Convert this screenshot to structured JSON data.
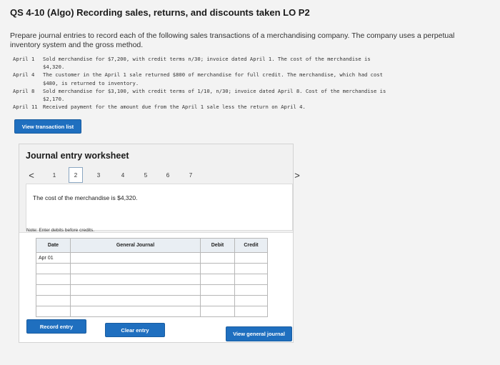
{
  "header": {
    "title": "QS 4-10 (Algo) Recording sales, returns, and discounts taken LO P2"
  },
  "instructions": "Prepare journal entries to record each of the following sales transactions of a merchandising company. The company uses a perpetual inventory system and the gross method.",
  "transactions": [
    {
      "date": "April 1",
      "line1": "Sold merchandise for $7,200, with credit terms n/30; invoice dated April 1. The cost of the merchandise is",
      "line2": "$4,320."
    },
    {
      "date": "April 4",
      "line1": "The customer in the April 1 sale returned $800 of merchandise for full credit. The merchandise, which had cost",
      "line2": "$480, is returned to inventory."
    },
    {
      "date": "April 8",
      "line1": "Sold merchandise for $3,100, with credit terms of 1/10, n/30; invoice dated April 8. Cost of the merchandise is",
      "line2": "$2,170."
    },
    {
      "date": "April 11",
      "line1": "Received payment for the amount due from the April 1 sale less the return on April 4.",
      "line2": ""
    }
  ],
  "buttons": {
    "view_transaction_list": "View transaction list",
    "record_entry": "Record entry",
    "clear_entry": "Clear entry",
    "view_general_journal": "View general journal"
  },
  "worksheet": {
    "title": "Journal entry worksheet",
    "pages": [
      "1",
      "2",
      "3",
      "4",
      "5",
      "6",
      "7"
    ],
    "active_page": "2",
    "prev_arrow": "<",
    "next_arrow": ">",
    "description": "The cost of the merchandise is $4,320.",
    "note": "Note: Enter debits before credits.",
    "columns": {
      "date": "Date",
      "general_journal": "General Journal",
      "debit": "Debit",
      "credit": "Credit"
    },
    "first_date": "Apr 01"
  },
  "colors": {
    "button_blue": "#1f6fbf",
    "header_gray": "#f1f1f1"
  }
}
